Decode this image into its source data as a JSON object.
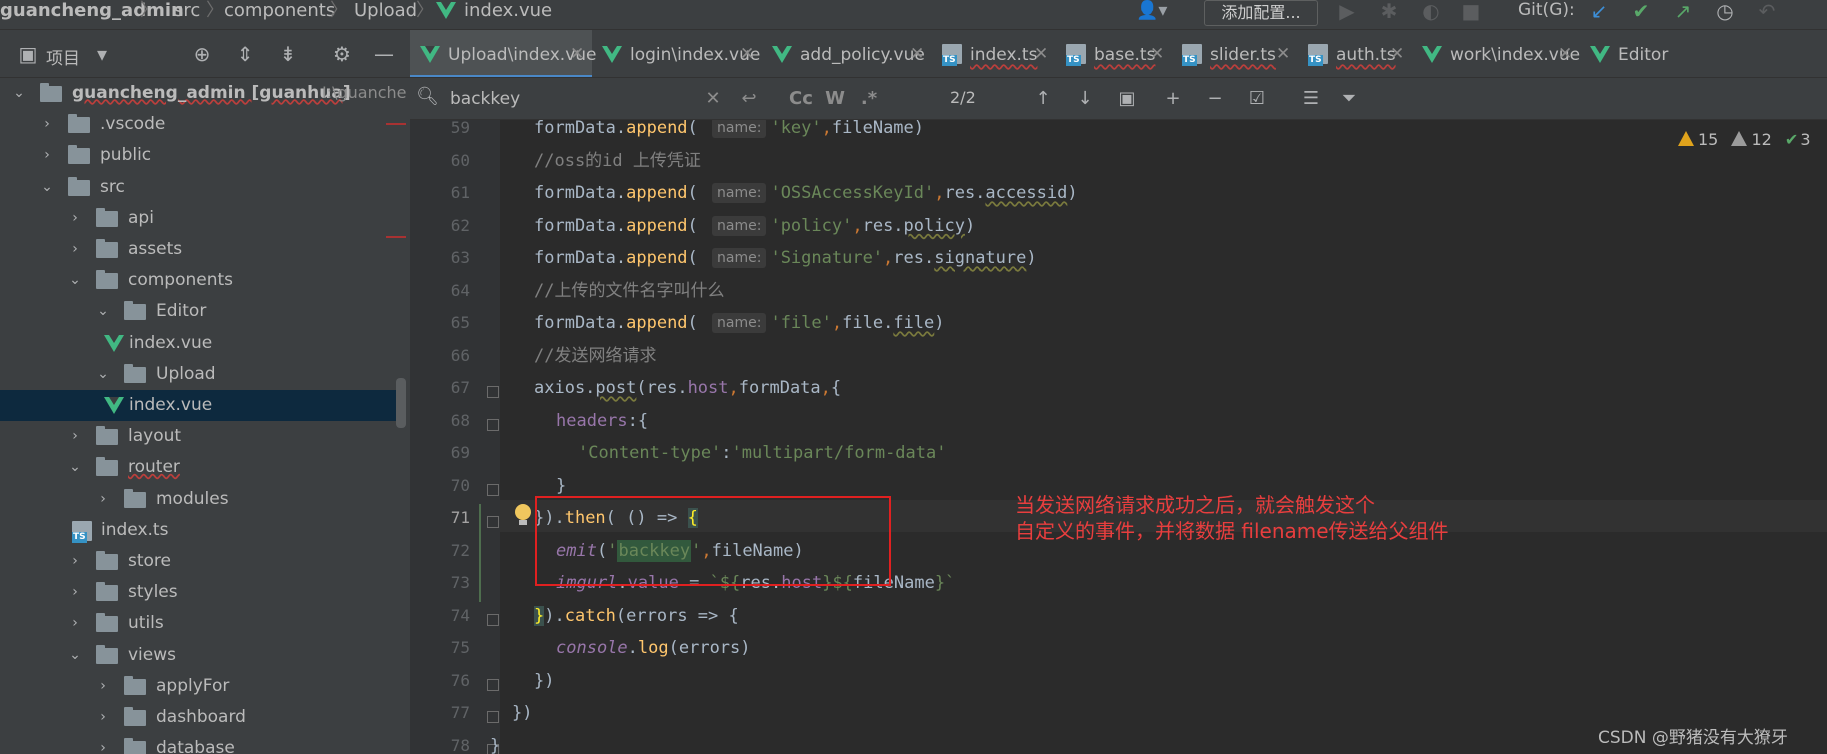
{
  "breadcrumb": [
    {
      "label": "guancheng_admin",
      "bold": true
    },
    {
      "label": "src"
    },
    {
      "label": "components"
    },
    {
      "label": "Upload"
    },
    {
      "label": "index.vue",
      "icon": "vue-icon"
    }
  ],
  "toolbar": {
    "config_label": "添加配置...",
    "git_label": "Git(G):",
    "icons": [
      "run-icon",
      "debug-icon",
      "coverage-icon",
      "stop-icon",
      "git-update-icon",
      "git-commit-icon",
      "git-push-icon",
      "history-icon",
      "rollback-icon"
    ]
  },
  "project_panel": {
    "title": "项目",
    "tree": [
      {
        "label": "guancheng_admin [guanhua]",
        "path": "I:\\guanche",
        "type": "folder",
        "depth": 0,
        "expanded": true,
        "bold": true
      },
      {
        "label": ".vscode",
        "type": "folder",
        "depth": 1,
        "expanded": false
      },
      {
        "label": "public",
        "type": "folder",
        "depth": 1,
        "expanded": false
      },
      {
        "label": "src",
        "type": "folder",
        "depth": 1,
        "expanded": true
      },
      {
        "label": "api",
        "type": "folder",
        "depth": 2,
        "expanded": false
      },
      {
        "label": "assets",
        "type": "folder",
        "depth": 2,
        "expanded": false
      },
      {
        "label": "components",
        "type": "folder",
        "depth": 2,
        "expanded": true
      },
      {
        "label": "Editor",
        "type": "folder",
        "depth": 3,
        "expanded": true
      },
      {
        "label": "index.vue",
        "type": "vue",
        "depth": 4
      },
      {
        "label": "Upload",
        "type": "folder",
        "depth": 3,
        "expanded": true
      },
      {
        "label": "index.vue",
        "type": "vue",
        "depth": 4,
        "selected": true
      },
      {
        "label": "layout",
        "type": "folder",
        "depth": 2,
        "expanded": false
      },
      {
        "label": "router",
        "type": "folder",
        "depth": 2,
        "expanded": true,
        "wavy": true
      },
      {
        "label": "modules",
        "type": "folder",
        "depth": 3,
        "expanded": false
      },
      {
        "label": "index.ts",
        "type": "ts",
        "depth": 3
      },
      {
        "label": "store",
        "type": "folder",
        "depth": 2,
        "expanded": false
      },
      {
        "label": "styles",
        "type": "folder",
        "depth": 2,
        "expanded": false
      },
      {
        "label": "utils",
        "type": "folder",
        "depth": 2,
        "expanded": false
      },
      {
        "label": "views",
        "type": "folder",
        "depth": 2,
        "expanded": true
      },
      {
        "label": "applyFor",
        "type": "folder",
        "depth": 3,
        "expanded": false
      },
      {
        "label": "dashboard",
        "type": "folder",
        "depth": 3,
        "expanded": false
      },
      {
        "label": "database",
        "type": "folder",
        "depth": 3,
        "expanded": false
      }
    ]
  },
  "tabs": [
    {
      "label": "Upload\\index.vue",
      "type": "vue",
      "active": true
    },
    {
      "label": "login\\index.vue",
      "type": "vue"
    },
    {
      "label": "add_policy.vue",
      "type": "vue"
    },
    {
      "label": "index.ts",
      "type": "ts"
    },
    {
      "label": "base.ts",
      "type": "ts"
    },
    {
      "label": "slider.ts",
      "type": "ts"
    },
    {
      "label": "auth.ts",
      "type": "ts"
    },
    {
      "label": "work\\index.vue",
      "type": "vue"
    },
    {
      "label": "Editor",
      "type": "vue"
    }
  ],
  "find": {
    "query": "backkey",
    "match_count": "2/2",
    "case_label": "Cc",
    "word_label": "W",
    "regex_label": ".*"
  },
  "inspections": {
    "warnings": "15",
    "weak_warnings": "12",
    "ok": "3"
  },
  "code_lines": [
    {
      "n": "59",
      "html": "formData.<span class='tok-method'>append</span>( <span class='tok-hint'>name:</span><span class='tok-str'>'key'</span><span class='tok-kw'>,</span>fileName)",
      "indent": 2
    },
    {
      "n": "60",
      "html": "<span class='tok-comment'>//oss的id 上传凭证</span>",
      "indent": 2
    },
    {
      "n": "61",
      "html": "formData.<span class='tok-method'>append</span>( <span class='tok-hint'>name:</span><span class='tok-str'>'OSSAccessKeyId'</span><span class='tok-kw'>,</span>res.<span class='wavy'>accessid</span>)",
      "indent": 2
    },
    {
      "n": "62",
      "html": "formData.<span class='tok-method'>append</span>( <span class='tok-hint'>name:</span><span class='tok-str'>'policy'</span><span class='tok-kw'>,</span>res.<span class='wavy'>policy</span>)",
      "indent": 2
    },
    {
      "n": "63",
      "html": "formData.<span class='tok-method'>append</span>( <span class='tok-hint'>name:</span><span class='tok-str'>'Signature'</span><span class='tok-kw'>,</span>res.<span class='wavy'>signature</span>)",
      "indent": 2
    },
    {
      "n": "64",
      "html": "<span class='tok-comment'>//上传的文件名字叫什么</span>",
      "indent": 2
    },
    {
      "n": "65",
      "html": "formData.<span class='tok-method'>append</span>( <span class='tok-hint'>name:</span><span class='tok-str'>'file'</span><span class='tok-kw'>,</span>file.<span class='wavy'>file</span>)",
      "indent": 2
    },
    {
      "n": "66",
      "html": "<span class='tok-comment'>//发送网络请求</span>",
      "indent": 2
    },
    {
      "n": "67",
      "html": "axios.<span class='wavy'>post</span>(res.<span class='tok-prop'>host</span><span class='tok-kw'>,</span>formData<span class='tok-kw'>,</span>{",
      "indent": 2
    },
    {
      "n": "68",
      "html": "<span class='tok-prop'>headers</span>:{",
      "indent": 3
    },
    {
      "n": "69",
      "html": "<span class='tok-str'>'Content-type'</span>:<span class='tok-str'>'multipart/form-data'</span>",
      "indent": 4
    },
    {
      "n": "70",
      "html": "}",
      "indent": 3
    },
    {
      "n": "71",
      "html": "}).<span class='tok-method'>then</span>( () => <span class='tok-brace'>{</span>",
      "indent": 2,
      "current": true
    },
    {
      "n": "72",
      "html": "<span class='tok-italic'>emit</span>(<span class='tok-str'>'<span class='tok-match'>backkey</span>'</span><span class='tok-kw'>,</span>fileName)",
      "indent": 3
    },
    {
      "n": "73",
      "html": "<span class='tok-italic'>imgurl</span>.<span class='tok-prop'>value</span> = <span class='tok-str'>`${</span>res.<span class='tok-prop'>host</span><span class='tok-str'>}${</span>fileName<span class='tok-str'>}`</span>",
      "indent": 3
    },
    {
      "n": "74",
      "html": "<span class='tok-brace'>}</span>).<span class='tok-method'>catch</span>(errors => {",
      "indent": 2
    },
    {
      "n": "75",
      "html": "<span class='tok-italic'>console</span>.<span class='tok-method'>log</span>(errors)",
      "indent": 3
    },
    {
      "n": "76",
      "html": "})",
      "indent": 2
    },
    {
      "n": "77",
      "html": "})",
      "indent": 1
    },
    {
      "n": "78",
      "html": "}",
      "indent": 0
    }
  ],
  "annotation": {
    "line1": "当发送网络请求成功之后，就会触发这个",
    "line2": "自定义的事件，并将数据 filename传送给父组件"
  },
  "watermark": "CSDN @野猪没有大獠牙"
}
